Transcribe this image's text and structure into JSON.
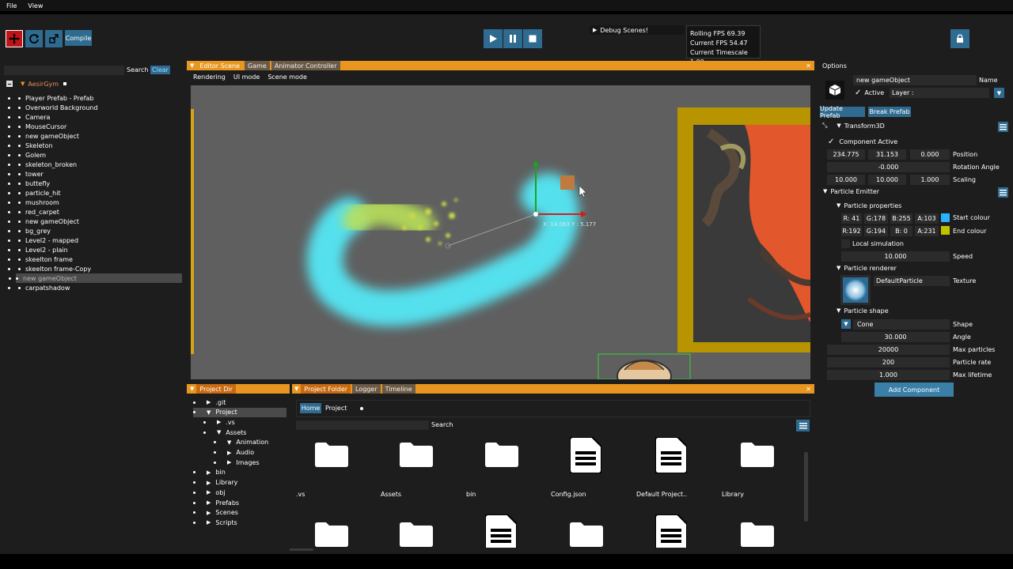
{
  "menu": {
    "file": "File",
    "view": "View"
  },
  "toolbar": {
    "compile": "Compile",
    "debug_scenes": "Debug Scenes!"
  },
  "stats": {
    "rolling_fps": "Rolling  FPS 69.39",
    "current_fps": "Current FPS 54.47",
    "timescale": "Current Timescale 1.00"
  },
  "hierarchy": {
    "search_label": "Search",
    "clear_label": "Clear",
    "scene": "AesirGym",
    "items": [
      "Player Prefab - Prefab",
      "Overworld Background",
      "Camera",
      "MouseCursor",
      "new gameObject",
      "Skeleton",
      "Golem",
      "skeleton_broken",
      "tower",
      "buttefly",
      "particle_hit",
      "mushroom",
      "red_carpet",
      "new gameObject",
      "bg_grey",
      "Level2 - mapped",
      "Level2 - plain",
      "skeelton frame",
      "skeelton frame-Copy",
      "new gameObject",
      "carpatshadow"
    ]
  },
  "editor": {
    "tabs": [
      "Editor Scene",
      "Game",
      "Animator Controller"
    ],
    "subtabs": [
      "Rendering",
      "UI mode",
      "Scene mode"
    ],
    "coord_readout": "X: 14.063 Y : 5.177"
  },
  "options": {
    "title": "Options",
    "object_name": "new gameObject",
    "name_label": "Name",
    "active_label": "Active",
    "layer_label": "Layer :",
    "update_prefab": "Update Prefab",
    "break_prefab": "Break Prefab",
    "transform": {
      "title": "Transform3D",
      "component_active": "Component Active",
      "position": [
        "234.775",
        "31.153",
        "0.000"
      ],
      "position_label": "Position",
      "rotation": "-0.000",
      "rotation_label": "Rotation Angle",
      "scaling": [
        "10.000",
        "10.000",
        "1.000"
      ],
      "scaling_label": "Scaling"
    },
    "particle_emitter": {
      "title": "Particle Emitter",
      "properties_title": "Particle properties",
      "start_colour": [
        "R: 41",
        "G:178",
        "B:255",
        "A:103"
      ],
      "start_colour_label": "Start colour",
      "start_colour_hex": "#29b2ff",
      "end_colour": [
        "R:192",
        "G:194",
        "B: 0",
        "A:231"
      ],
      "end_colour_label": "End colour",
      "end_colour_hex": "#c0c200",
      "local_simulation": "Local simulation",
      "speed": "10.000",
      "speed_label": "Speed",
      "renderer_title": "Particle renderer",
      "texture_value": "DefaultParticle",
      "texture_label": "Texture",
      "shape_title": "Particle shape",
      "shape_value": "Cone",
      "shape_label": "Shape",
      "angle": "30.000",
      "angle_label": "Angle",
      "max_particles": "20000",
      "max_particles_label": "Max particles",
      "particle_rate": "200",
      "particle_rate_label": "Particle rate",
      "max_lifetime": "1.000",
      "max_lifetime_label": "Max lifetime"
    },
    "add_component": "Add Component"
  },
  "project_dir": {
    "title": "Project Dir",
    "items": [
      ".git",
      "Project",
      ".vs",
      "Assets",
      "Animation",
      "Audio",
      "Images",
      "bin",
      "Library",
      "obj",
      "Prefabs",
      "Scenes",
      "Scripts"
    ]
  },
  "project_folder": {
    "tabs": [
      "Project Folder",
      "Logger",
      "Timeline"
    ],
    "home": "Home",
    "project": "Project",
    "search_label": "Search",
    "files": [
      ".vs",
      "Assets",
      "bin",
      "Config.json",
      "Default Project..",
      "Library"
    ]
  },
  "colors": {
    "accent": "#e8961f",
    "button": "#2f6b91",
    "scene_bg": "#5f5f5f"
  }
}
